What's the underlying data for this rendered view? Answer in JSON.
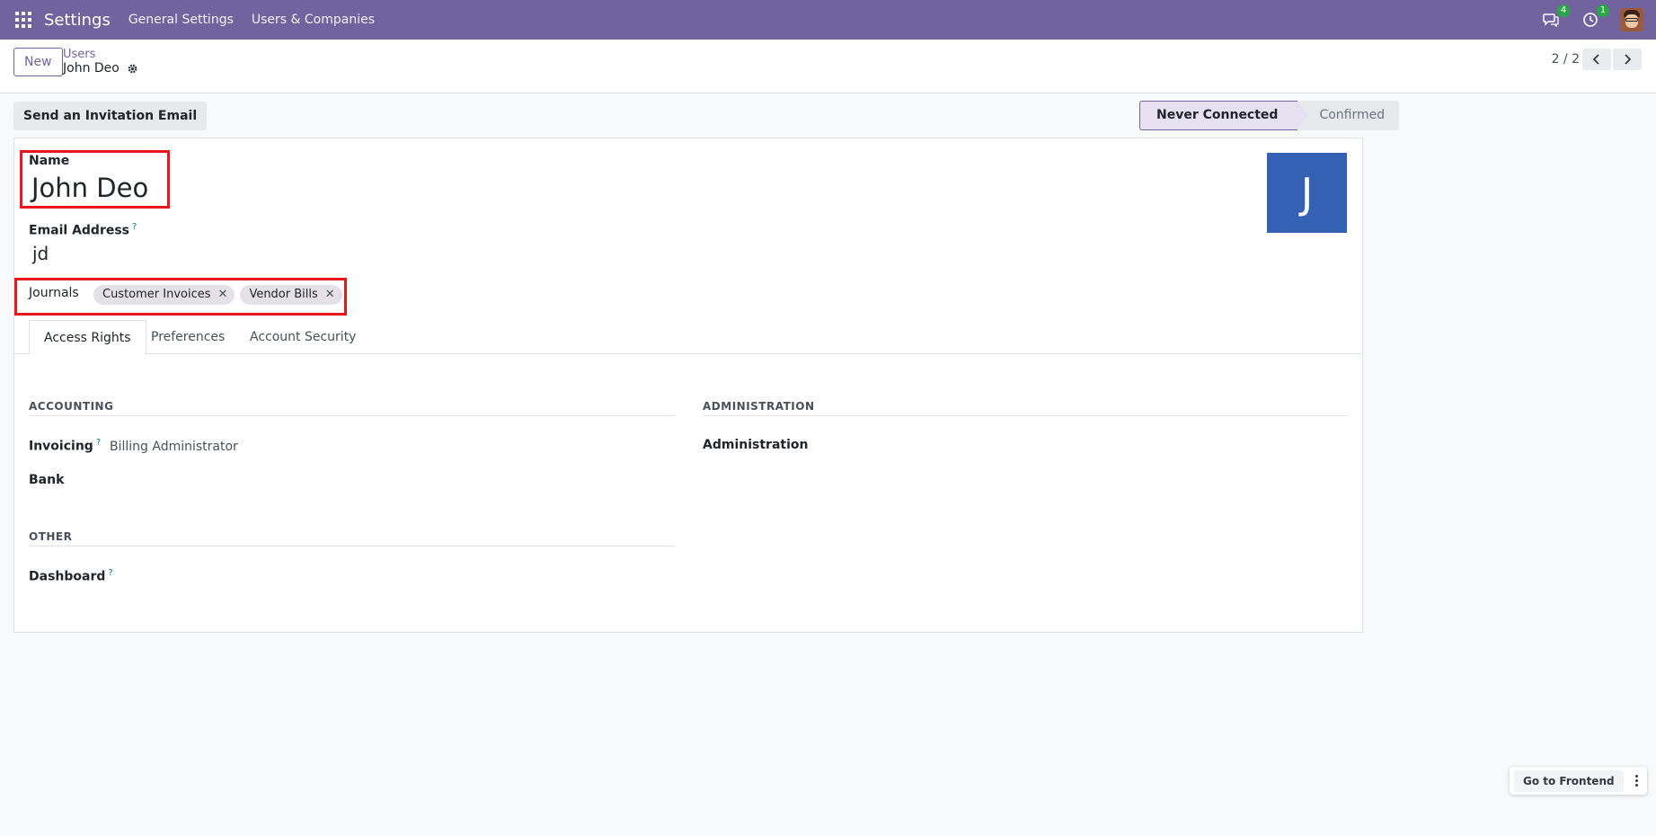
{
  "navbar": {
    "app_name": "Settings",
    "links": [
      "General Settings",
      "Users & Companies"
    ],
    "messages_count": "4",
    "activities_count": "1"
  },
  "control_panel": {
    "new_label": "New",
    "breadcrumb_parent": "Users",
    "breadcrumb_current": "John Deo",
    "pager": "2 / 2"
  },
  "header": {
    "invite_label": "Send an Invitation Email",
    "status_active": "Never Connected",
    "status_next": "Confirmed"
  },
  "form": {
    "name_label": "Name",
    "name_value": "John Deo",
    "email_label": "Email Address",
    "email_help": "?",
    "email_value": "jd",
    "avatar_initial": "J",
    "journals_label": "Journals",
    "journal_tags": [
      "Customer Invoices",
      "Vendor Bills"
    ],
    "tag_remove": "✕"
  },
  "tabs": [
    "Access Rights",
    "Preferences",
    "Account Security"
  ],
  "access": {
    "accounting_title": "ACCOUNTING",
    "invoicing_label": "Invoicing",
    "invoicing_value": "Billing Administrator",
    "bank_label": "Bank",
    "administration_title": "ADMINISTRATION",
    "administration_label": "Administration",
    "other_title": "OTHER",
    "dashboard_label": "Dashboard",
    "help": "?"
  },
  "footer": {
    "frontend_label": "Go to Frontend"
  },
  "colors": {
    "navbar": "#71639e",
    "avatar": "#3561b5",
    "highlight_box": "#e8171b",
    "badge": "#28a745"
  }
}
